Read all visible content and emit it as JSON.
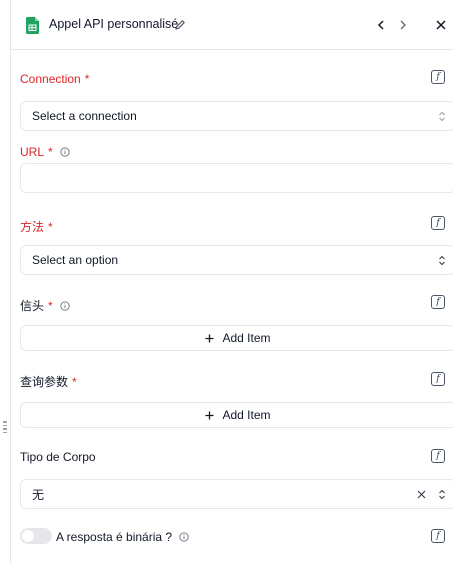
{
  "header": {
    "title": "Appel API personnalisé",
    "app_icon": "google-sheets-icon",
    "colors": {
      "sheets_green": "#1ea362"
    }
  },
  "fields": {
    "connection": {
      "label": "Connection",
      "required_mark": "*",
      "placeholder_value": "Select a connection"
    },
    "url": {
      "label": "URL",
      "required_mark": "*",
      "value": ""
    },
    "method": {
      "label": "方法",
      "required_mark": "*",
      "value": "Select an option"
    },
    "headers": {
      "label": "信头",
      "required_mark": "*",
      "add_label": "Add Item"
    },
    "query_params": {
      "label": "查询参数",
      "required_mark": "*",
      "add_label": "Add Item"
    },
    "body_type": {
      "label": "Tipo de Corpo",
      "value": "无"
    },
    "binary_response": {
      "label": "A resposta é binária ?",
      "enabled": false
    }
  },
  "colors": {
    "required_red": "#dc2626",
    "border": "#e5e7eb"
  }
}
